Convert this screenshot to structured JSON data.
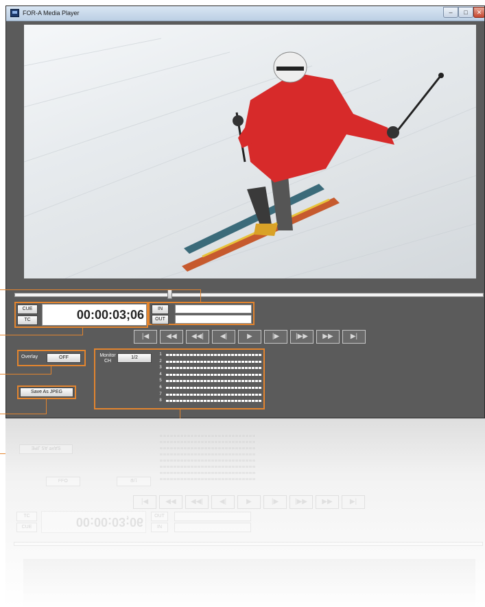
{
  "window": {
    "title": "FOR-A Media Player",
    "controls": {
      "minimize": "–",
      "maximize": "□",
      "close": "✕"
    }
  },
  "player": {
    "cue_label": "CUE",
    "tc_label": "TC",
    "timecode": "00:00:03;06",
    "in_label": "IN",
    "out_label": "OUT",
    "in_value": "",
    "out_value": "",
    "seek_position": 0.33
  },
  "transport": [
    {
      "name": "go-to-start-button",
      "icon": "skip-start-icon",
      "glyph": "|◀"
    },
    {
      "name": "rewind-button",
      "icon": "rewind-icon",
      "glyph": "◀◀"
    },
    {
      "name": "step-back-fast-button",
      "icon": "step-back-fast-icon",
      "glyph": "◀◀|"
    },
    {
      "name": "step-back-button",
      "icon": "step-back-icon",
      "glyph": "◀|"
    },
    {
      "name": "play-button",
      "icon": "play-icon",
      "glyph": "▶"
    },
    {
      "name": "step-forward-button",
      "icon": "step-forward-icon",
      "glyph": "|▶"
    },
    {
      "name": "step-forward-fast-button",
      "icon": "step-forward-fast-icon",
      "glyph": "|▶▶"
    },
    {
      "name": "fast-forward-button",
      "icon": "fast-forward-icon",
      "glyph": "▶▶"
    },
    {
      "name": "go-to-end-button",
      "icon": "skip-end-icon",
      "glyph": "▶|"
    }
  ],
  "overlay": {
    "label": "Overlay",
    "value": "OFF"
  },
  "monitor": {
    "label": "Monitor\nCH",
    "value": "1/2"
  },
  "save_button": "Save As JPEG",
  "audio_channels": [
    "1",
    "2",
    "3",
    "4",
    "5",
    "6",
    "7",
    "8"
  ],
  "colors": {
    "highlight": "#e3852f",
    "panel": "#5b5b5b",
    "titlebar": "#cfdcec"
  }
}
